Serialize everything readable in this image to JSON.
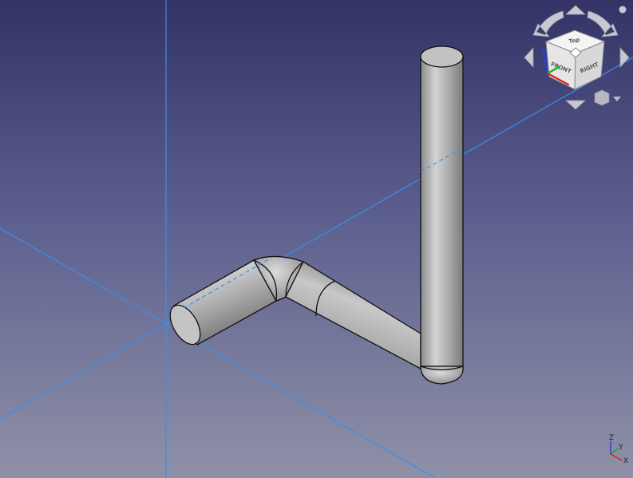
{
  "navigation_cube": {
    "faces": {
      "top": "Top",
      "front": "FRONT",
      "right": "RIGHT"
    },
    "colors": {
      "cube_face": "#eeeeee",
      "cube_edge": "#888888",
      "arrow": "#c8c8d2",
      "x_axis": "#e02020",
      "y_axis": "#10b010",
      "z_axis": "#2040e0"
    }
  },
  "axis_indicator": {
    "x_label": "X",
    "y_label": "Y",
    "z_label": "Z"
  },
  "scene": {
    "object": "pipe",
    "axis_line_color": "#3a8fe8",
    "pipe_color": "#a8a8a8"
  }
}
